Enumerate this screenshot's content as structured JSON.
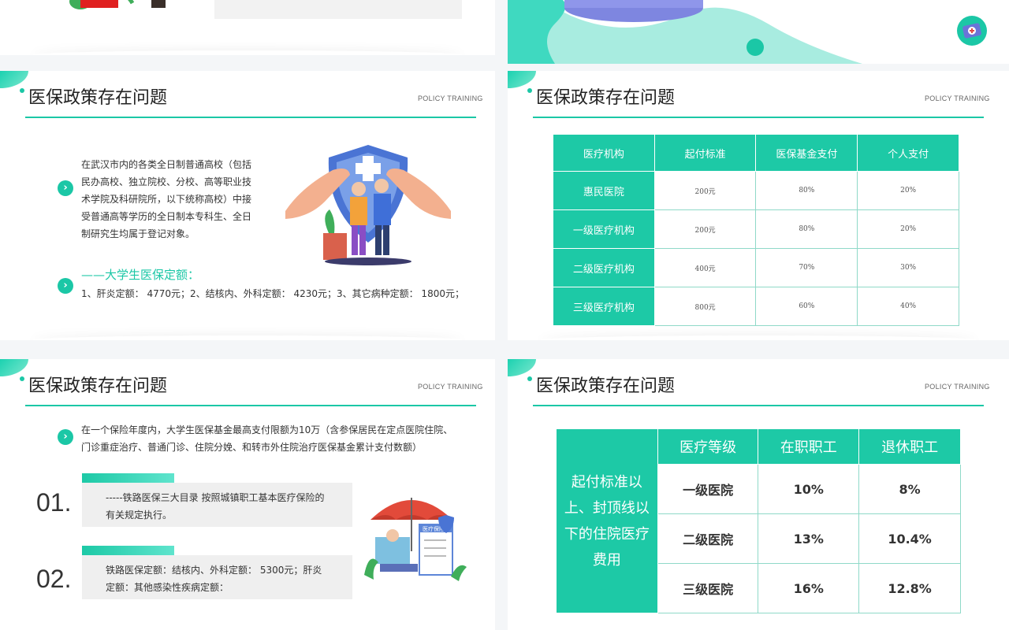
{
  "policy_label": "POLICY TRAINING",
  "slide_title": "医保政策存在问题",
  "slide1": {
    "paragraph": "在武汉市内的各类全日制普通高校（包括民办高校、独立院校、分校、高等职业技术学院及科研院所，以下统称高校）中接受普通高等学历的全日制本专科生、全日制研究生均属于登记对象。",
    "quota_heading": "——大学生医保定额：",
    "quota_text": "1、肝炎定额： 4770元；2、结核内、外科定额： 4230元；3、其它病种定额： 1800元；"
  },
  "slide2": {
    "headers": [
      "医疗机构",
      "起付标准",
      "医保基金支付",
      "个人支付"
    ],
    "rows": [
      [
        "惠民医院",
        "200元",
        "80%",
        "20%"
      ],
      [
        "一级医疗机构",
        "200元",
        "80%",
        "20%"
      ],
      [
        "二级医疗机构",
        "400元",
        "70%",
        "30%"
      ],
      [
        "三级医疗机构",
        "800元",
        "60%",
        "40%"
      ]
    ]
  },
  "slide3": {
    "paragraph": "在一个保险年度内，大学生医保基金最高支付限额为10万（含参保居民在定点医院住院、门诊重症治疗、普通门诊、住院分娩、和转市外住院治疗医保基金累计支付数额）",
    "items": [
      {
        "num": "01.",
        "text": "-----铁路医保三大目录 按照城镇职工基本医疗保险的有关规定执行。"
      },
      {
        "num": "02.",
        "text": "铁路医保定额：结核内、外科定额： 5300元；肝炎定额：其他感染性疾病定额："
      }
    ],
    "form_label": "医疗保险"
  },
  "slide4": {
    "merged_label": "起付标准以上、封顶线以下的住院医疗费用",
    "headers": [
      "医疗等级",
      "在职职工",
      "退休职工"
    ],
    "rows": [
      [
        "一级医院",
        "10%",
        "8%"
      ],
      [
        "二级医院",
        "13%",
        "10.4%"
      ],
      [
        "三级医院",
        "16%",
        "12.8%"
      ]
    ]
  }
}
